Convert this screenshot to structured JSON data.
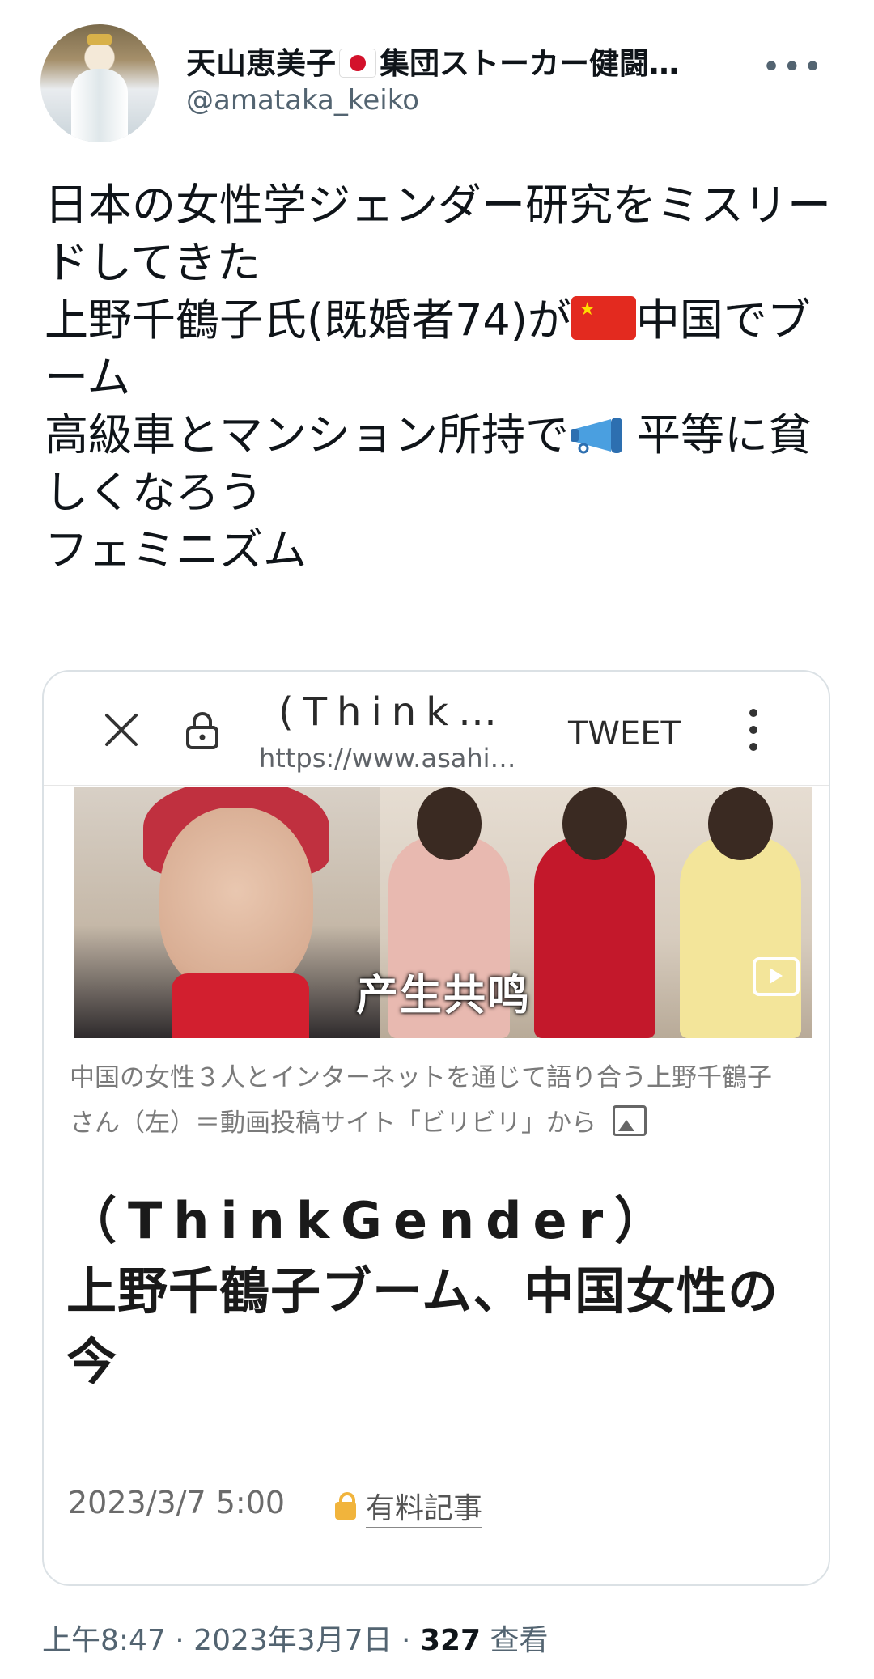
{
  "author": {
    "display_name": "天山恵美子",
    "display_name_suffix": "集団ストーカー健闘…",
    "handle": "@amataka_keiko",
    "more_label": "•••"
  },
  "tweet": {
    "line1": "日本の女性学ジェンダー研究をミスリードしてきた",
    "line2a": "上野千鶴子氏(既婚者74)が",
    "line2b": "中国でブーム",
    "line3a": "高級車とマンション所持で",
    "line3b": "平等に貧しくなろう",
    "line4": "フェミニズム"
  },
  "card": {
    "page_title": "(Think…",
    "url": "https://www.asahi…",
    "tweet_button": "TWEET",
    "image_overlay_text": "产生共鸣",
    "image_caption": "中国の女性３人とインターネットを通じて語り合う上野千鶴子さん（左）＝動画投稿サイト「ビリビリ」から",
    "title_en": "（ThinkGender）",
    "title_jp": "上野千鶴子ブーム、中国女性の今",
    "date": "2023/3/7 5:00",
    "paid_label": "有料記事"
  },
  "footer": {
    "time": "上午8:47 · 2023年3月7日 · ",
    "views": "327",
    "views_label": " 查看"
  },
  "icons": {
    "flag_jp": "flag-japan-icon",
    "flag_cn": "flag-china-icon",
    "megaphone": "megaphone-icon",
    "close": "close-icon",
    "lock": "lock-icon",
    "kebab": "kebab-menu-icon",
    "play": "play-icon",
    "image": "image-icon"
  },
  "colors": {
    "text": "#0f1419",
    "secondary": "#536471",
    "card_border": "#dbe1e5",
    "lock_gold": "#f1b43c"
  }
}
